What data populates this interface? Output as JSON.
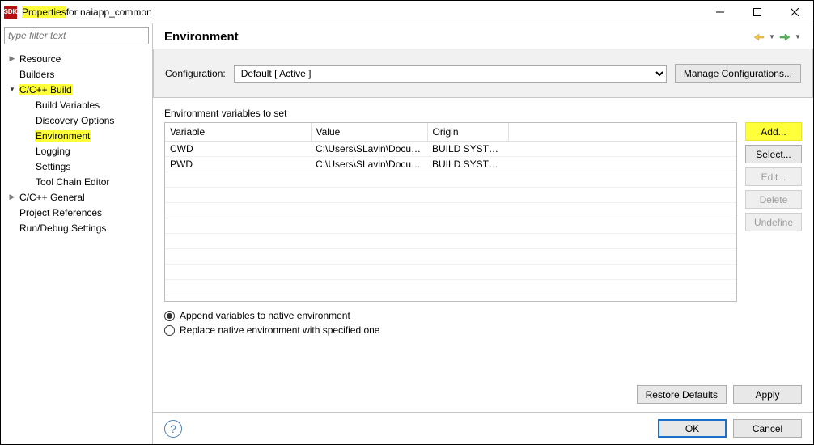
{
  "window": {
    "title_prefix": "Properties",
    "title_suffix": " for naiapp_common"
  },
  "sidebar": {
    "filter_placeholder": "type filter text",
    "items": {
      "resource": "Resource",
      "builders": "Builders",
      "ccpp_build": "C/C++ Build",
      "build_variables": "Build Variables",
      "discovery_options": "Discovery Options",
      "environment": "Environment",
      "logging": "Logging",
      "settings": "Settings",
      "tool_chain_editor": "Tool Chain Editor",
      "ccpp_general": "C/C++ General",
      "project_references": "Project References",
      "run_debug_settings": "Run/Debug Settings"
    }
  },
  "heading": "Environment",
  "config": {
    "label": "Configuration:",
    "selected": "Default  [ Active ]",
    "manage_btn": "Manage Configurations..."
  },
  "table": {
    "caption": "Environment variables to set",
    "columns": {
      "variable": "Variable",
      "value": "Value",
      "origin": "Origin"
    },
    "rows": [
      {
        "variable": "CWD",
        "value": "C:\\Users\\SLavin\\Docum...",
        "origin": "BUILD SYSTEM"
      },
      {
        "variable": "PWD",
        "value": "C:\\Users\\SLavin\\Docum...",
        "origin": "BUILD SYSTEM"
      }
    ]
  },
  "side_buttons": {
    "add": "Add...",
    "select": "Select...",
    "edit": "Edit...",
    "delete": "Delete",
    "undefine": "Undefine"
  },
  "radios": {
    "append": "Append variables to native environment",
    "replace": "Replace native environment with specified one"
  },
  "bottom_buttons": {
    "restore": "Restore Defaults",
    "apply": "Apply",
    "ok": "OK",
    "cancel": "Cancel"
  }
}
